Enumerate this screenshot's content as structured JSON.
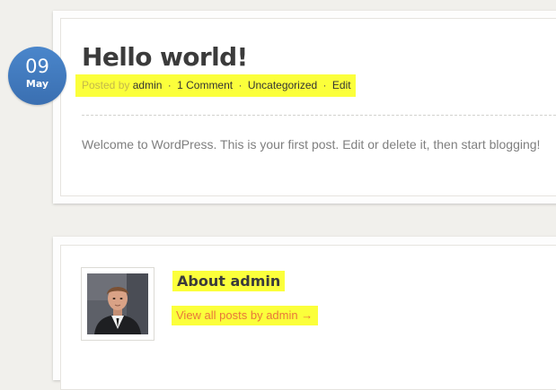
{
  "post": {
    "date": {
      "day": "09",
      "month": "May"
    },
    "title": "Hello world!",
    "meta": {
      "posted_by_label": "Posted by",
      "author": "admin",
      "separator": "·",
      "comments": "1 Comment",
      "category": "Uncategorized",
      "edit": "Edit"
    },
    "content": "Welcome to WordPress. This is your first post. Edit or delete it, then start blogging!"
  },
  "author_box": {
    "title": "About admin",
    "link_text": "View all posts by admin →"
  },
  "colors": {
    "background": "#f1f0ec",
    "date_badge": "#3f79bf",
    "highlight": "#fbff3b",
    "link_orange": "#e8773a"
  }
}
